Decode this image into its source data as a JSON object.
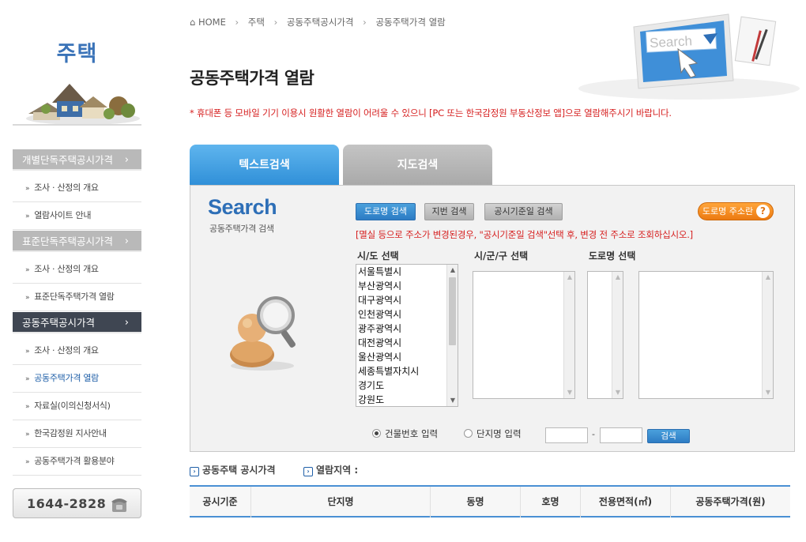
{
  "sidebar": {
    "title": "주택",
    "sections": [
      {
        "label": "개별단독주택공시가격",
        "chevron": "›",
        "active": false,
        "items": [
          "조사 · 산정의 개요",
          "열람사이트 안내"
        ]
      },
      {
        "label": "표준단독주택공시가격",
        "chevron": "›",
        "active": false,
        "items": [
          "조사 · 산정의 개요",
          "표준단독주택가격 열람"
        ]
      },
      {
        "label": "공동주택공시가격",
        "chevron": "›",
        "active": true,
        "items": [
          "조사 · 산정의 개요",
          "공동주택가격 열람",
          "자료실(이의신청서식)",
          "한국감정원 지사안내",
          "공동주택가격 활용분야"
        ],
        "current_item": "공동주택가격 열람"
      }
    ],
    "phone": "1644-2828"
  },
  "breadcrumb": {
    "home": "HOME",
    "items": [
      "주택",
      "공동주택공시가격",
      "공동주택가격 열람"
    ]
  },
  "header": {
    "title": "공동주택가격 열람",
    "art_text": "Search",
    "notice": "* 휴대폰 등 모바일 기기 이용시 원활한 열람이 어려울 수 있으니 [PC 또는 한국감정원 부동산정보 앱]으로 열람해주시기 바랍니다."
  },
  "tabs": [
    {
      "label": "텍스트검색",
      "active": true
    },
    {
      "label": "지도검색",
      "active": false
    }
  ],
  "search_panel": {
    "logo": "Search",
    "logo_sub": "공동주택가격 검색",
    "buttons": {
      "road": "도로명 검색",
      "lot": "지번 검색",
      "date": "공시기준일 검색",
      "locator": "도로명 주소란",
      "locator_icon": "?"
    },
    "note": "[멸실 등으로 주소가 변경된경우, \"공시기준일 검색\"선택 후, 변경 전 주소로 조회하십시오.]",
    "columns": {
      "sido": "시/도 선택",
      "sigungu": "시/군/구 선택",
      "road": "도로명 선택"
    },
    "sido_options": [
      "서울특별시",
      "부산광역시",
      "대구광역시",
      "인천광역시",
      "광주광역시",
      "대전광역시",
      "울산광역시",
      "세종특별자치시",
      "경기도",
      "강원도"
    ],
    "radio": {
      "building": "건물번호 입력",
      "complex": "단지명 입력",
      "selected": "building"
    },
    "dash": "-",
    "search_button": "검색"
  },
  "results": {
    "label1": "공동주택 공시가격",
    "label2": "열람지역 :",
    "marker": "›",
    "headers": [
      "공시기준",
      "단지명",
      "동명",
      "호명",
      "전용면적(㎡)",
      "공동주택가격(원)"
    ]
  },
  "colors": {
    "accent_blue": "#2e6fb7",
    "tab_blue": "#3f9be3",
    "notice_red": "#d61f1f",
    "active_menu": "#3f4652",
    "locator_orange": "#ec7a12"
  }
}
